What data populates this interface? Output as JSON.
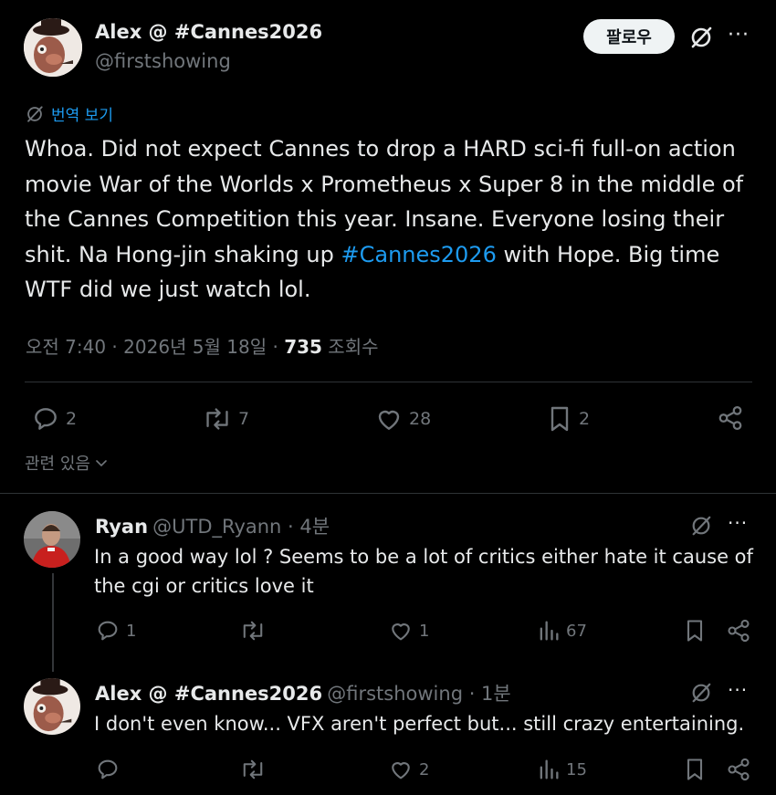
{
  "main_tweet": {
    "author_name": "Alex @ #Cannes2026",
    "author_handle": "@firstshowing",
    "follow_label": "팔로우",
    "translate_label": "번역 보기",
    "text_before": "Whoa. Did not expect Cannes to drop a HARD sci-fi full-on action movie War of the Worlds x Prometheus x Super 8 in the middle of the Cannes Competition this year. Insane. Everyone losing their shit. Na Hong-jin shaking up ",
    "hashtag": "#Cannes2026",
    "text_after": " with Hope. Big time WTF did we just watch lol.",
    "timestamp": "오전 7:40 · 2026년 5월 18일 · ",
    "views_count": "735",
    "views_label": " 조회수",
    "replies": "2",
    "reposts": "7",
    "likes": "28",
    "bookmarks": "2",
    "related_label": "관련 있음"
  },
  "replies": [
    {
      "author_name": "Ryan",
      "author_handle": "@UTD_Ryann",
      "time": " · 4분",
      "text": "In a good way lol ? Seems to be a lot of critics either hate it cause of the cgi or critics love it",
      "replies": "1",
      "reposts": "",
      "likes": "1",
      "views": "67"
    },
    {
      "author_name": "Alex @ #Cannes2026",
      "author_handle": "@firstshowing",
      "time": " · 1분",
      "text": "I don't even know... VFX aren't perfect but... still crazy entertaining.",
      "replies": "",
      "reposts": "",
      "likes": "2",
      "views": "15"
    }
  ],
  "colors": {
    "background": "#000000",
    "text": "#e7e9ea",
    "muted": "#71767b",
    "link": "#1d9bf0",
    "divider": "#2f3336"
  }
}
